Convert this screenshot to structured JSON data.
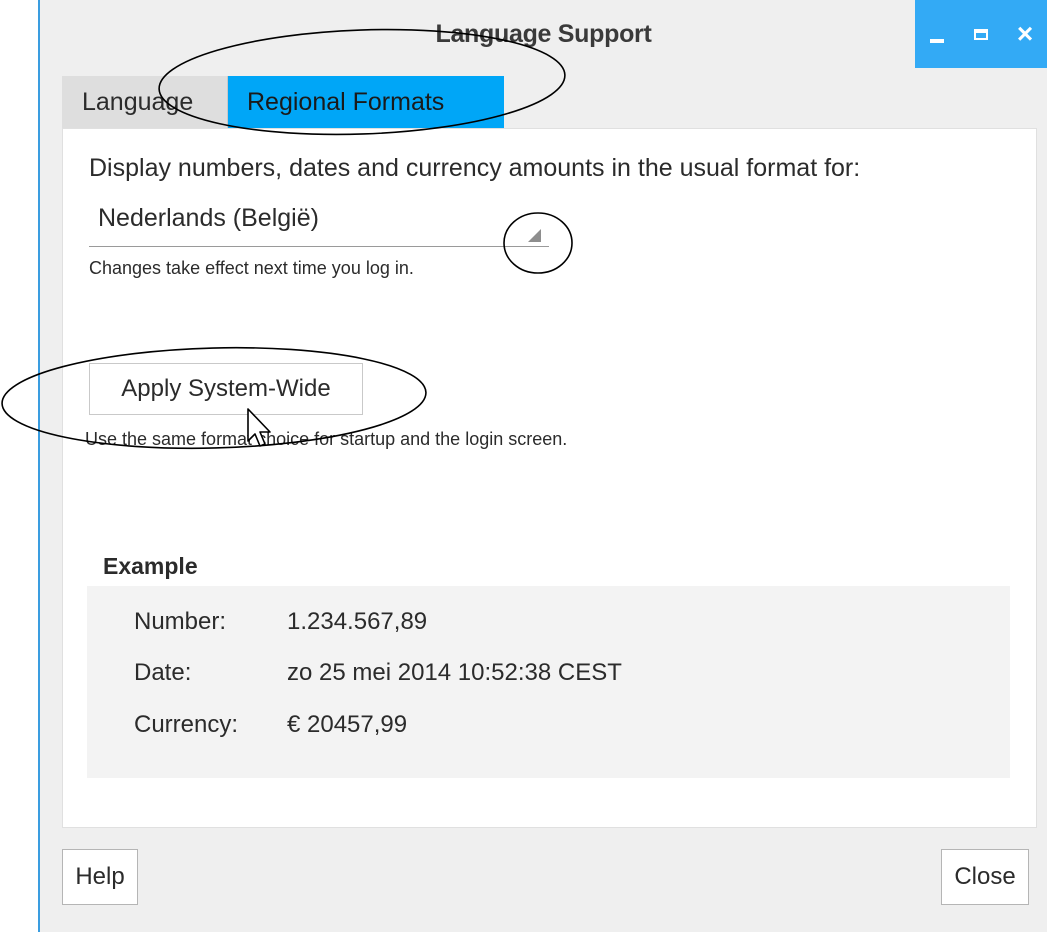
{
  "window": {
    "title": "Language Support"
  },
  "tabs": [
    {
      "label": "Language"
    },
    {
      "label": "Regional Formats"
    }
  ],
  "regional": {
    "prompt": "Display numbers, dates and currency amounts in the usual format for:",
    "selected_format": "Nederlands (België)",
    "login_hint": "Changes take effect next time you log in.",
    "apply_button": "Apply System-Wide",
    "apply_hint": "Use the same format choice for startup and the login screen."
  },
  "example": {
    "title": "Example",
    "rows": [
      {
        "label": "Number:",
        "value": "1.234.567,89"
      },
      {
        "label": "Date:",
        "value": "zo 25 mei 2014 10:52:38 CEST"
      },
      {
        "label": "Currency:",
        "value": "€ 20457,99"
      }
    ]
  },
  "footer": {
    "help": "Help",
    "close": "Close"
  },
  "icons": [
    "minimize-icon",
    "maximize-icon",
    "close-icon",
    "dropdown-arrow-icon",
    "mouse-cursor-icon"
  ],
  "colors": {
    "accent": "#00a6f7",
    "titlebar_buttons": "#33aaf5"
  }
}
